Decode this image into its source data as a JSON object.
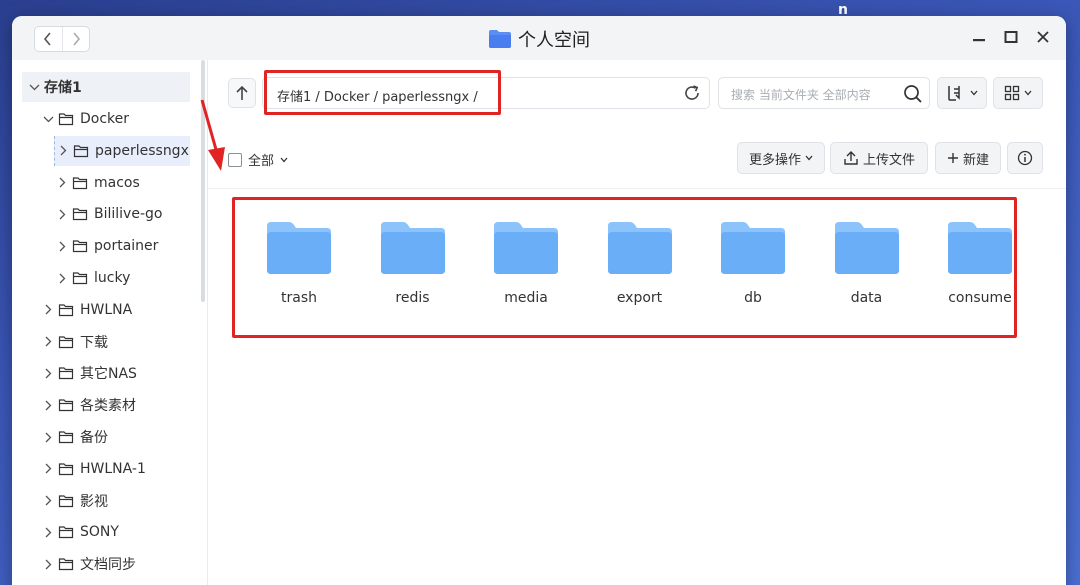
{
  "window": {
    "title": "个人空间"
  },
  "desktop_glyph": "n",
  "sidebar": {
    "root": {
      "label": "存储1"
    },
    "items": [
      {
        "label": "Docker",
        "level": 1,
        "expanded": true
      },
      {
        "label": "paperlessngx",
        "level": 2,
        "selected": true
      },
      {
        "label": "macos",
        "level": 2
      },
      {
        "label": "Bililive-go",
        "level": 2
      },
      {
        "label": "portainer",
        "level": 2
      },
      {
        "label": "lucky",
        "level": 2
      },
      {
        "label": "HWLNA",
        "level": 1
      },
      {
        "label": "下载",
        "level": 1
      },
      {
        "label": "其它NAS",
        "level": 1
      },
      {
        "label": "各类素材",
        "level": 1
      },
      {
        "label": "备份",
        "level": 1
      },
      {
        "label": "HWLNA-1",
        "level": 1
      },
      {
        "label": "影视",
        "level": 1
      },
      {
        "label": "SONY",
        "level": 1
      },
      {
        "label": "文档同步",
        "level": 1
      }
    ]
  },
  "toolbar": {
    "path": "存储1 / Docker / paperlessngx /",
    "search_placeholder": "搜索 当前文件夹 全部内容",
    "select_all": "全部",
    "more_actions": "更多操作",
    "upload": "上传文件",
    "new": "新建"
  },
  "folders": [
    "trash",
    "redis",
    "media",
    "export",
    "db",
    "data",
    "consume"
  ],
  "colors": {
    "annotation": "#e02424",
    "folder_front": "#6aaef8",
    "folder_back": "#8cc3fb"
  }
}
